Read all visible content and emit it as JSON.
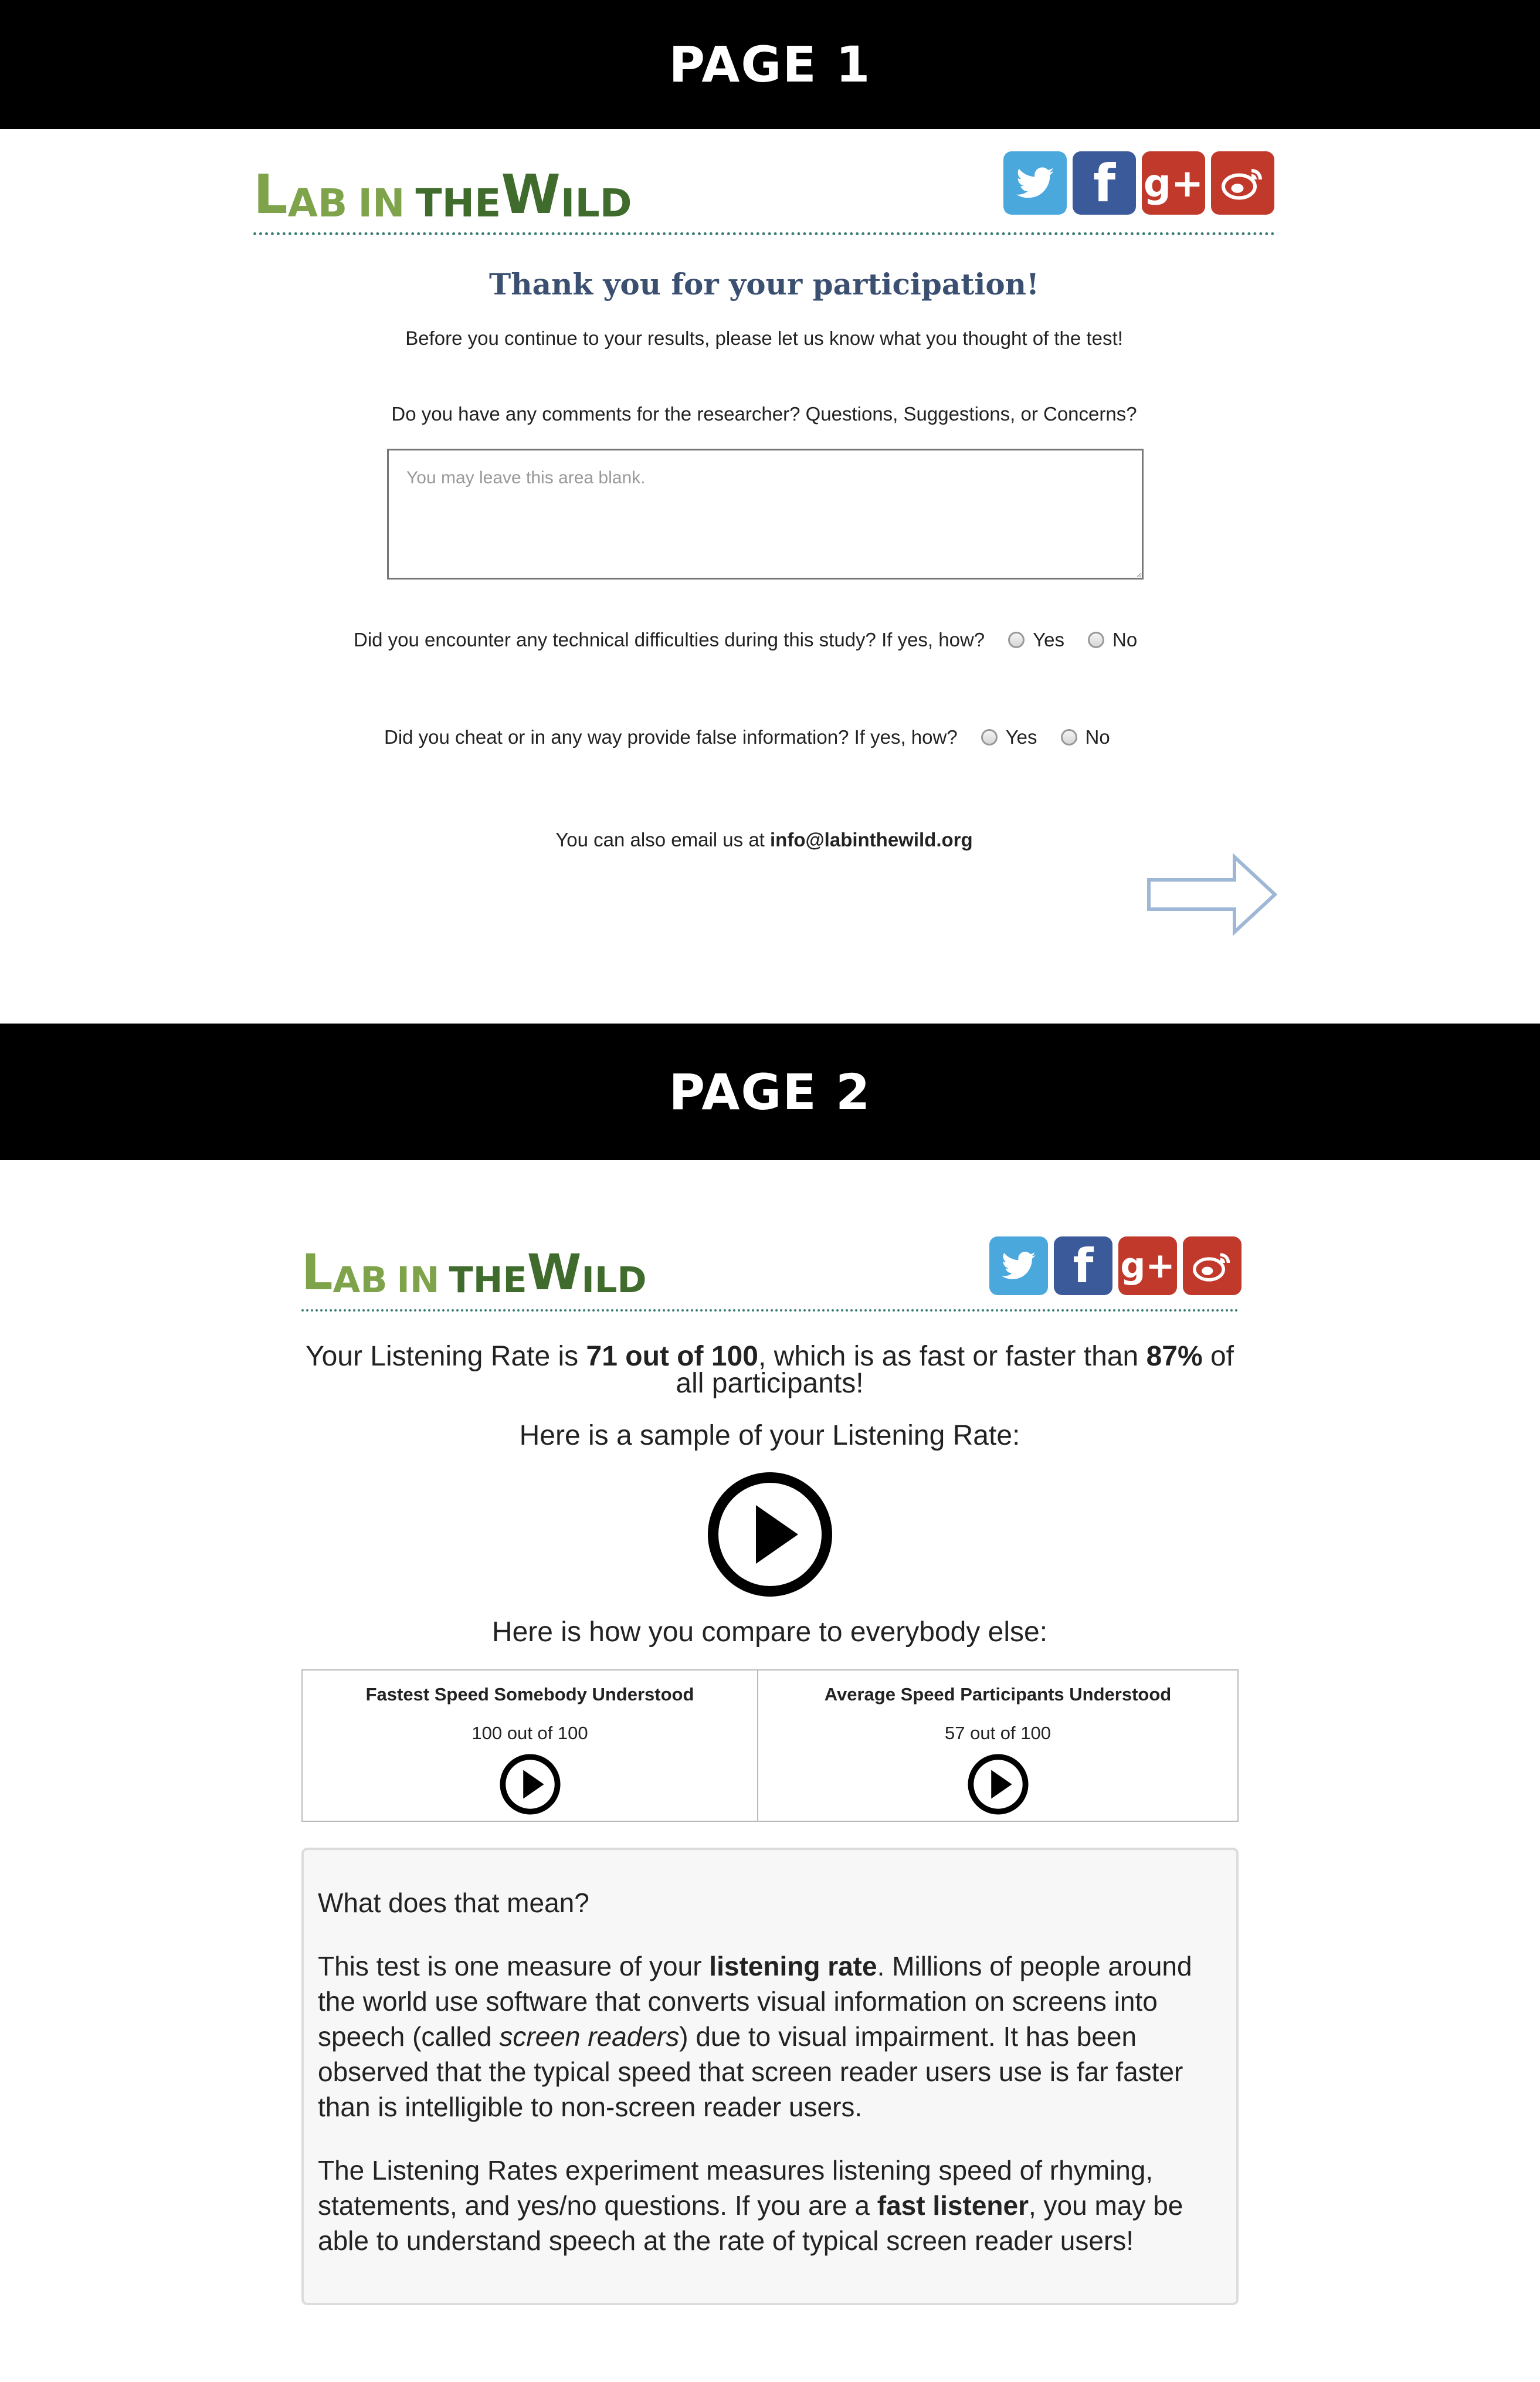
{
  "banners": {
    "page1": "PAGE 1",
    "page2": "PAGE 2"
  },
  "brand": {
    "lab": "L",
    "lab_rest": "AB",
    "in": "IN",
    "the": "THE",
    "wild_w": "W",
    "wild_rest": "ILD"
  },
  "social": [
    {
      "name": "twitter",
      "color": "#4aa8dd"
    },
    {
      "name": "facebook",
      "color": "#3b5a9a"
    },
    {
      "name": "google-plus",
      "color": "#c0392b"
    },
    {
      "name": "weibo",
      "color": "#c0392b"
    }
  ],
  "page1": {
    "title": "Thank you for your participation!",
    "intro": "Before you continue to your results, please let us know what you thought of the test!",
    "comments_question": "Do you have any comments for the researcher? Questions, Suggestions, or Concerns?",
    "comments_placeholder": "You may leave this area blank.",
    "technical_question": "Did you encounter any technical difficulties during this study? If yes, how?",
    "cheat_question": "Did you cheat or in any way provide false information? If yes, how?",
    "yes_label": "Yes",
    "no_label": "No",
    "email_prefix": "You can also email us at ",
    "email": "info@labinthewild.org"
  },
  "page2": {
    "rate_prefix": "Your Listening Rate is ",
    "rate_value": "71 out of 100",
    "rate_middle": ", which is as fast or faster than ",
    "rate_percent": "87%",
    "rate_suffix": " of all participants!",
    "sample_label": "Here is a sample of your Listening Rate:",
    "compare_label": "Here is how you compare to everybody else:",
    "fastest_header": "Fastest Speed Somebody Understood",
    "fastest_value": "100 out of 100",
    "average_header": "Average Speed Participants Understood",
    "average_value": "57 out of 100",
    "meaning_title": "What does that mean?",
    "p1_a": "This test is one measure of your ",
    "p1_bold": "listening rate",
    "p1_b": ". Millions of people around the world use software that converts visual information on screens into speech (called ",
    "p1_italic": "screen readers",
    "p1_c": ") due to visual impairment. It has been observed that the typical speed that screen reader users use is far faster than is intelligible to non-screen reader users.",
    "p2_a": "The Listening Rates experiment measures listening speed of rhyming, statements, and yes/no questions. If you are a ",
    "p2_bold": "fast listener",
    "p2_b": ", you may be able to understand speech at the rate of typical screen reader users!"
  }
}
